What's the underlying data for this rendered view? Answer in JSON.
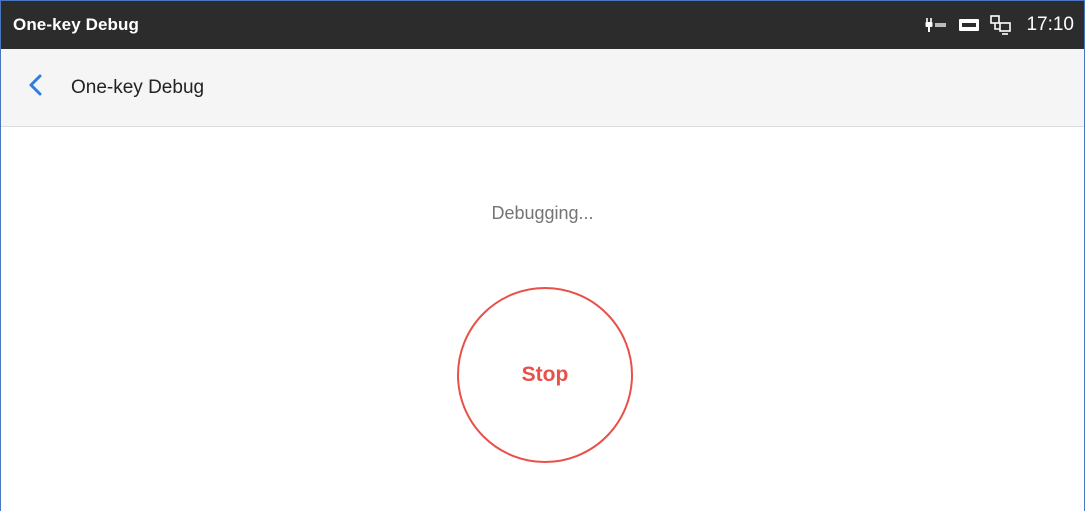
{
  "status_bar": {
    "title": "One-key Debug",
    "time": "17:10",
    "icons": [
      "poe-power-icon",
      "ftp-icon",
      "network-icon"
    ]
  },
  "app_bar": {
    "title": "One-key Debug",
    "back_icon": "chevron-left-icon"
  },
  "main": {
    "status_text": "Debugging...",
    "stop_label": "Stop"
  },
  "colors": {
    "status_bar_bg": "#2c2c2c",
    "app_bar_bg": "#f5f5f5",
    "accent_blue": "#2f7de1",
    "stop_red": "#e8504a",
    "muted_text": "#757575"
  }
}
